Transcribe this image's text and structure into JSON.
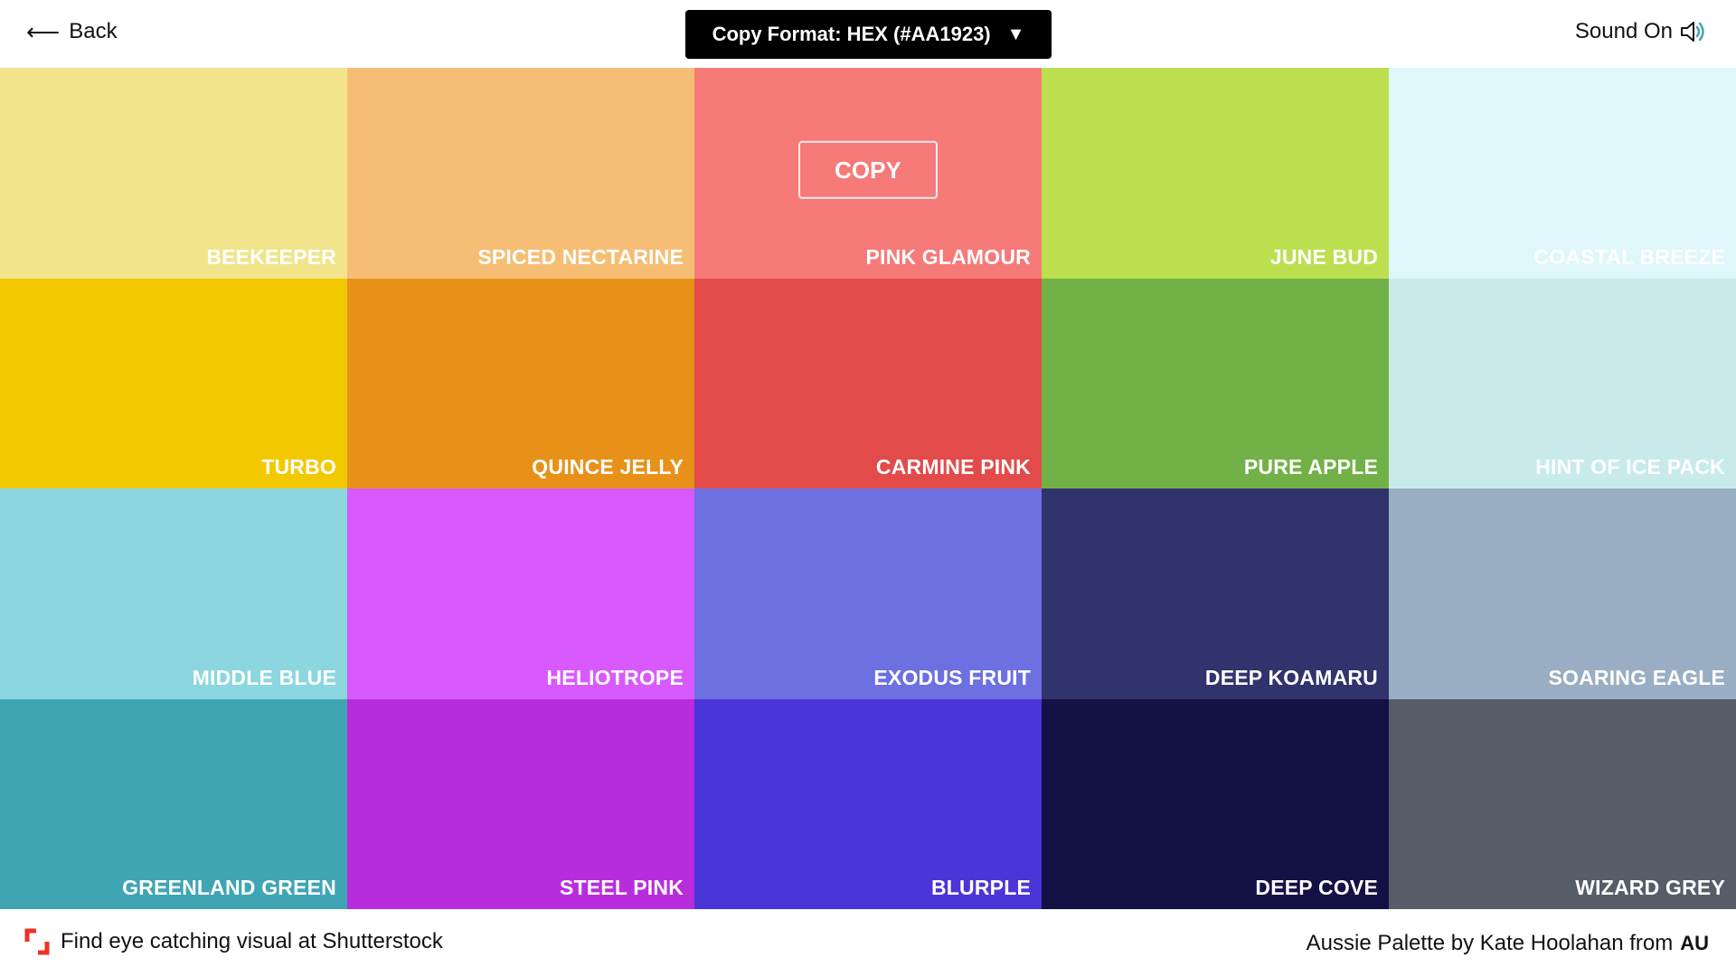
{
  "header": {
    "back_label": "Back",
    "format_label": "Copy Format: HEX (#AA1923)",
    "sound_label": "Sound On"
  },
  "copy_label": "COPY",
  "swatches": [
    {
      "name": "BEEKEEPER",
      "color": "#f1e48b"
    },
    {
      "name": "SPICED NECTARINE",
      "color": "#f6be74"
    },
    {
      "name": "PINK GLAMOUR",
      "color": "#f67a78"
    },
    {
      "name": "JUNE BUD",
      "color": "#bcdf50"
    },
    {
      "name": "COASTAL BREEZE",
      "color": "#dff7fa"
    },
    {
      "name": "TURBO",
      "color": "#f2c900"
    },
    {
      "name": "QUINCE JELLY",
      "color": "#e89119"
    },
    {
      "name": "CARMINE PINK",
      "color": "#e24b4a"
    },
    {
      "name": "PURE APPLE",
      "color": "#72b147"
    },
    {
      "name": "HINT OF ICE PACK",
      "color": "#c8eaeb"
    },
    {
      "name": "MIDDLE BLUE",
      "color": "#8bd6df"
    },
    {
      "name": "HELIOTROPE",
      "color": "#d85aff"
    },
    {
      "name": "EXODUS FRUIT",
      "color": "#6c70e1"
    },
    {
      "name": "DEEP KOAMARU",
      "color": "#31336d"
    },
    {
      "name": "SOARING EAGLE",
      "color": "#99aec2"
    },
    {
      "name": "GREENLAND GREEN",
      "color": "#3fa5b2"
    },
    {
      "name": "STEEL PINK",
      "color": "#b72ddd"
    },
    {
      "name": "BLURPLE",
      "color": "#4a35d8"
    },
    {
      "name": "DEEP COVE",
      "color": "#141244"
    },
    {
      "name": "WIZARD GREY",
      "color": "#565c68"
    }
  ],
  "footer": {
    "shutterstock_text": "Find eye catching visual at Shutterstock",
    "credit_text": "Aussie Palette by Kate Hoolahan from",
    "country_code": "AU"
  },
  "icons": {
    "back": "arrow-left-icon",
    "format": "caret-down-icon",
    "sound": "speaker-icon",
    "shutterstock": "shutterstock-logo-icon"
  },
  "colors": {
    "header_button_bg": "#000000",
    "shutterstock_red": "#ee3124"
  }
}
